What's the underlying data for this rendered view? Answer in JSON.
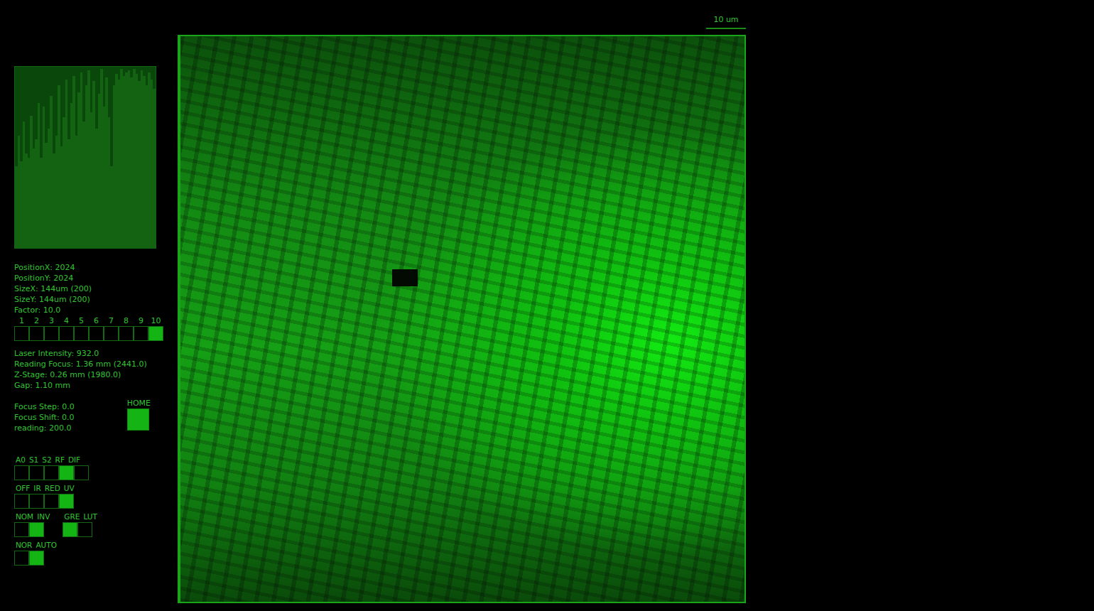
{
  "scale_bar": {
    "label": "10 um"
  },
  "histogram": {
    "values": [
      0.45,
      0.62,
      0.48,
      0.7,
      0.52,
      0.5,
      0.73,
      0.55,
      0.6,
      0.8,
      0.5,
      0.78,
      0.58,
      0.66,
      0.84,
      0.52,
      0.62,
      0.9,
      0.56,
      0.72,
      0.93,
      0.6,
      0.8,
      0.95,
      0.62,
      0.86,
      0.97,
      0.7,
      0.9,
      0.98,
      0.75,
      0.92,
      0.66,
      0.85,
      0.99,
      0.78,
      0.94,
      0.72,
      0.45,
      0.9,
      0.96,
      0.93,
      0.99,
      0.95,
      0.97,
      0.98,
      0.94,
      0.99,
      0.96,
      0.92,
      0.98,
      0.95,
      0.9,
      0.97,
      0.93,
      0.88
    ]
  },
  "info": [
    "PositionX: 2024",
    "PositionY: 2024",
    "SizeX: 144um (200)",
    "SizeY: 144um (200)",
    "Factor: 10.0"
  ],
  "factor": [
    {
      "label": "1",
      "selected": false
    },
    {
      "label": "2",
      "selected": false
    },
    {
      "label": "3",
      "selected": false
    },
    {
      "label": "4",
      "selected": false
    },
    {
      "label": "5",
      "selected": false
    },
    {
      "label": "6",
      "selected": false
    },
    {
      "label": "7",
      "selected": false
    },
    {
      "label": "8",
      "selected": false
    },
    {
      "label": "9",
      "selected": false
    },
    {
      "label": "10",
      "selected": true
    }
  ],
  "laser": [
    "Laser Intensity: 932.0",
    "Reading Focus: 1.36 mm (2441.0)",
    "Z-Stage: 0.26 mm (1980.0)",
    "Gap: 1.10 mm"
  ],
  "focus": [
    "Focus Step: 0.0",
    "Focus Shift: 0.0",
    "reading: 200.0"
  ],
  "home": {
    "label": "HOME"
  },
  "control_rows": [
    {
      "groups": [
        {
          "options": [
            {
              "label": "A0",
              "selected": false
            },
            {
              "label": "S1",
              "selected": false
            },
            {
              "label": "S2",
              "selected": false
            },
            {
              "label": "RF",
              "selected": true
            },
            {
              "label": "DIF",
              "selected": false
            }
          ]
        }
      ]
    },
    {
      "groups": [
        {
          "options": [
            {
              "label": "OFF",
              "selected": false
            },
            {
              "label": "IR",
              "selected": false
            },
            {
              "label": "RED",
              "selected": false
            },
            {
              "label": "UV",
              "selected": true
            }
          ]
        }
      ]
    },
    {
      "groups": [
        {
          "options": [
            {
              "label": "NOM",
              "selected": false
            },
            {
              "label": "INV",
              "selected": true
            }
          ]
        },
        {
          "options": [
            {
              "label": "GRE",
              "selected": true
            },
            {
              "label": "LUT",
              "selected": false
            }
          ]
        }
      ]
    },
    {
      "groups": [
        {
          "options": [
            {
              "label": "NOR",
              "selected": false
            },
            {
              "label": "AUTO",
              "selected": true
            }
          ]
        }
      ]
    }
  ]
}
